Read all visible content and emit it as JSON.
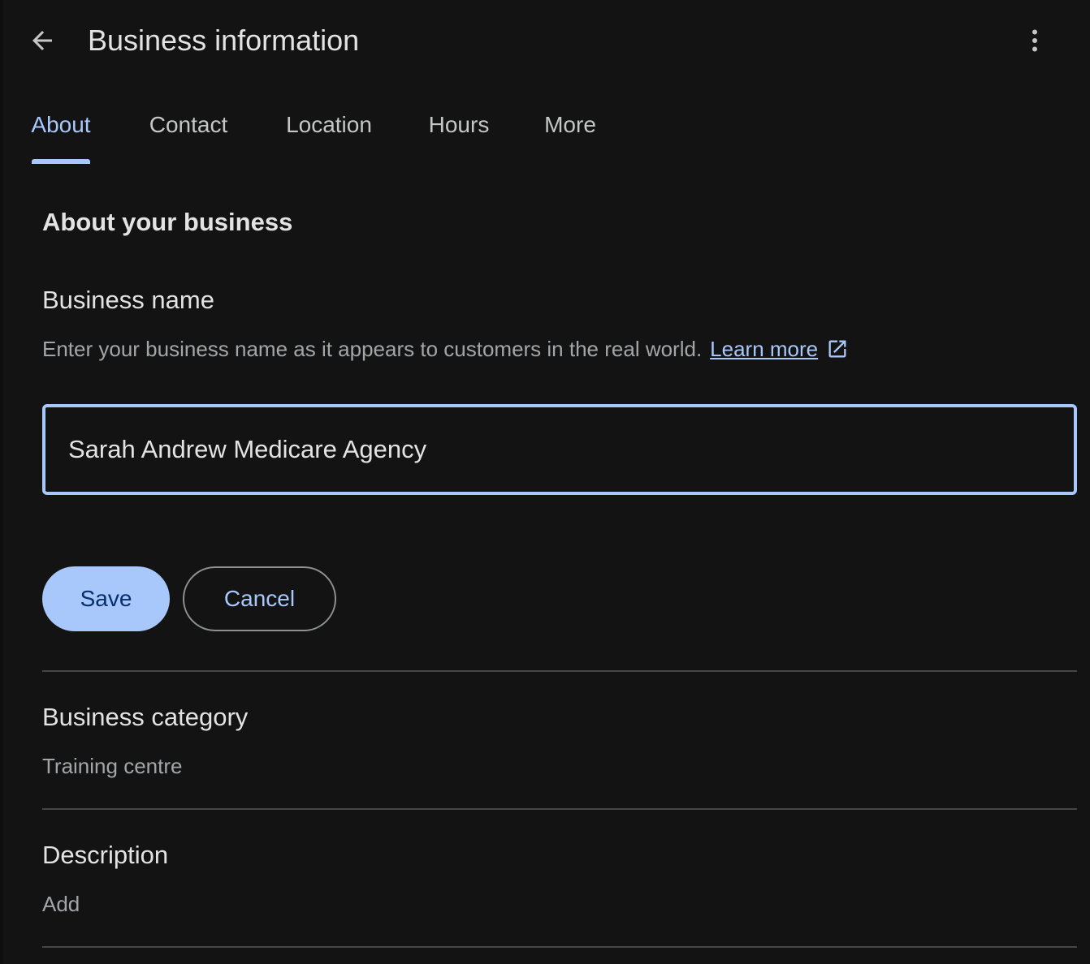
{
  "header": {
    "title": "Business information",
    "back_icon": "arrow-back-icon",
    "more_icon": "more-vert-icon"
  },
  "tabs": [
    {
      "label": "About",
      "active": true
    },
    {
      "label": "Contact",
      "active": false
    },
    {
      "label": "Location",
      "active": false
    },
    {
      "label": "Hours",
      "active": false
    },
    {
      "label": "More",
      "active": false
    }
  ],
  "about": {
    "section_title": "About your business",
    "business_name": {
      "label": "Business name",
      "help_text": "Enter your business name as it appears to customers in the real world.",
      "learn_more": "Learn more",
      "link_icon": "open-in-new-icon",
      "value": "Sarah Andrew Medicare Agency"
    },
    "save_label": "Save",
    "cancel_label": "Cancel",
    "business_category": {
      "label": "Business category",
      "value": "Training centre"
    },
    "description": {
      "label": "Description",
      "value": "Add"
    }
  },
  "colors": {
    "background": "#131314",
    "accent": "#a8c7fa",
    "text_primary": "#e3e3e3",
    "text_secondary": "#a3a6a9",
    "divider": "#444746",
    "save_text": "#062e6f"
  }
}
